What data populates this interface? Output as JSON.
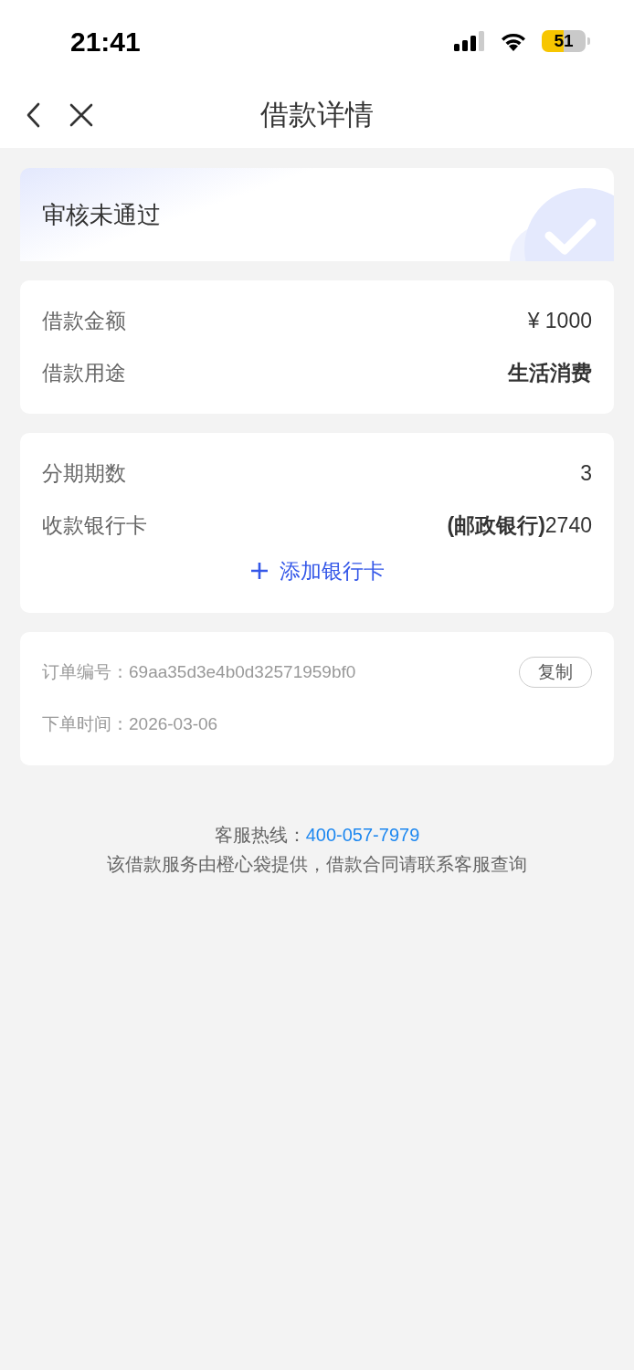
{
  "status_bar": {
    "time": "21:41",
    "battery": "51"
  },
  "nav": {
    "title": "借款详情"
  },
  "status_card": {
    "title": "审核未通过"
  },
  "loan_card": {
    "rows": [
      {
        "label": "借款金额",
        "value": "¥ 1000",
        "emphasis": false
      },
      {
        "label": "借款用途",
        "value": "生活消费",
        "emphasis": true
      }
    ]
  },
  "bank_card": {
    "rows": [
      {
        "label": "分期期数",
        "value": "3",
        "emphasis": false
      },
      {
        "label": "收款银行卡",
        "value": "**(邮政银行)**2740",
        "emphasis": false
      }
    ],
    "add_link": "添加银行卡"
  },
  "order_card": {
    "rows": [
      {
        "label": "订单编号：",
        "value": "69aa35d3e4b0d32571959bf0",
        "button": "复制"
      },
      {
        "label": "下单时间：",
        "value": "2026-03-06"
      }
    ]
  },
  "footer": {
    "hotline_label": "客服热线：",
    "hotline": "400-057-7979",
    "note": "该借款服务由橙心袋提供，借款合同请联系客服查询"
  }
}
